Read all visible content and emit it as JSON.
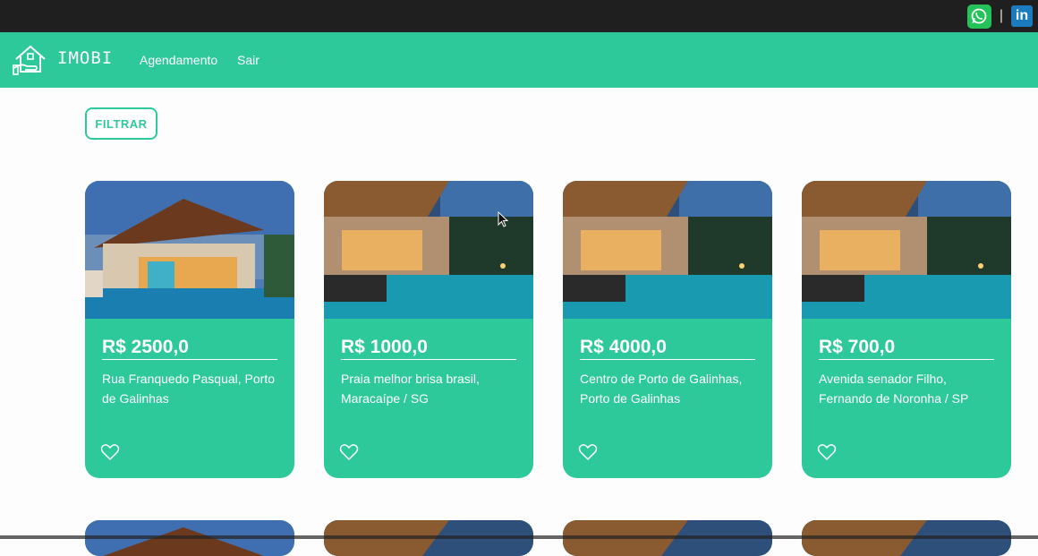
{
  "app": {
    "brand": "IMOBI"
  },
  "nav": {
    "items": [
      {
        "label": "Agendamento"
      },
      {
        "label": "Sair"
      }
    ]
  },
  "filter": {
    "label": "FILTRAR"
  },
  "social": {
    "icons": [
      "whatsapp-icon",
      "linkedin-icon"
    ],
    "separator": "|",
    "linkedin_text": "in"
  },
  "colors": {
    "accent": "#2ec99a",
    "topbar": "#1f1f1f",
    "whatsapp": "#25c25a",
    "linkedin": "#1a7bbf"
  },
  "listings": [
    {
      "price": "R$ 2500,0",
      "address": "Rua Franquedo Pasqual, Porto de Galinhas"
    },
    {
      "price": "R$ 1000,0",
      "address": "Praia melhor brisa brasil, Maracaípe / SG"
    },
    {
      "price": "R$ 4000,0",
      "address": "Centro de Porto de Galinhas, Porto de Galinhas"
    },
    {
      "price": "R$ 700,0",
      "address": "Avenida senador Filho, Fernando de Noronha / SP"
    }
  ]
}
